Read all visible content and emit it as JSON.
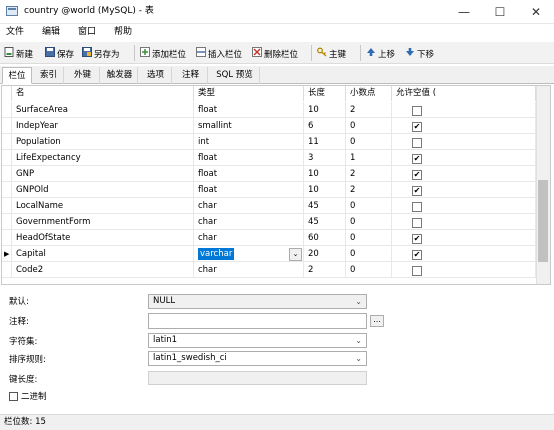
{
  "window": {
    "title": "country @world (MySQL) - 表",
    "min_glyph": "—",
    "max_glyph": "☐",
    "close_glyph": "✕"
  },
  "menu": [
    "文件",
    "编辑",
    "窗口",
    "帮助"
  ],
  "toolbar": [
    {
      "label": "新建",
      "icon": "new-icon"
    },
    {
      "label": "保存",
      "icon": "save-icon"
    },
    {
      "label": "另存为",
      "icon": "save-as-icon"
    },
    {
      "label": "添加栏位",
      "icon": "add-field-icon"
    },
    {
      "label": "插入栏位",
      "icon": "insert-field-icon"
    },
    {
      "label": "删除栏位",
      "icon": "delete-field-icon"
    },
    {
      "label": "主键",
      "icon": "key-icon"
    },
    {
      "label": "上移",
      "icon": "up-arrow-icon"
    },
    {
      "label": "下移",
      "icon": "down-arrow-icon"
    }
  ],
  "tabs": [
    "栏位",
    "索引",
    "外键",
    "触发器",
    "选项",
    "注释",
    "SQL 预览"
  ],
  "grid": {
    "headers": [
      "名",
      "类型",
      "长度",
      "小数点",
      "允许空值 ("
    ],
    "rows": [
      {
        "name": "SurfaceArea",
        "type": "float",
        "length": "10",
        "decimals": "2",
        "nullable": false
      },
      {
        "name": "IndepYear",
        "type": "smallint",
        "length": "6",
        "decimals": "0",
        "nullable": true
      },
      {
        "name": "Population",
        "type": "int",
        "length": "11",
        "decimals": "0",
        "nullable": false
      },
      {
        "name": "LifeExpectancy",
        "type": "float",
        "length": "3",
        "decimals": "1",
        "nullable": true
      },
      {
        "name": "GNP",
        "type": "float",
        "length": "10",
        "decimals": "2",
        "nullable": true
      },
      {
        "name": "GNPOld",
        "type": "float",
        "length": "10",
        "decimals": "2",
        "nullable": true
      },
      {
        "name": "LocalName",
        "type": "char",
        "length": "45",
        "decimals": "0",
        "nullable": false
      },
      {
        "name": "GovernmentForm",
        "type": "char",
        "length": "45",
        "decimals": "0",
        "nullable": false
      },
      {
        "name": "HeadOfState",
        "type": "char",
        "length": "60",
        "decimals": "0",
        "nullable": true
      },
      {
        "name": "Capital",
        "type": "varchar",
        "length": "20",
        "decimals": "0",
        "nullable": true
      },
      {
        "name": "Code2",
        "type": "char",
        "length": "2",
        "decimals": "0",
        "nullable": false
      }
    ],
    "selected_row_index": 9
  },
  "properties": {
    "default_label": "默认:",
    "default_value": "NULL",
    "comment_label": "注释:",
    "comment_value": "",
    "comment_button": "...",
    "charset_label": "字符集:",
    "charset_value": "latin1",
    "collation_label": "排序规则:",
    "collation_value": "latin1_swedish_ci",
    "keylength_label": "键长度:",
    "keylength_value": "",
    "binary_label": "二进制",
    "binary_checked": false
  },
  "status": {
    "field_count": "栏位数: 15"
  },
  "colors": {
    "selection": "#0078d7",
    "toolbar_bg": "#f2f2f2"
  }
}
